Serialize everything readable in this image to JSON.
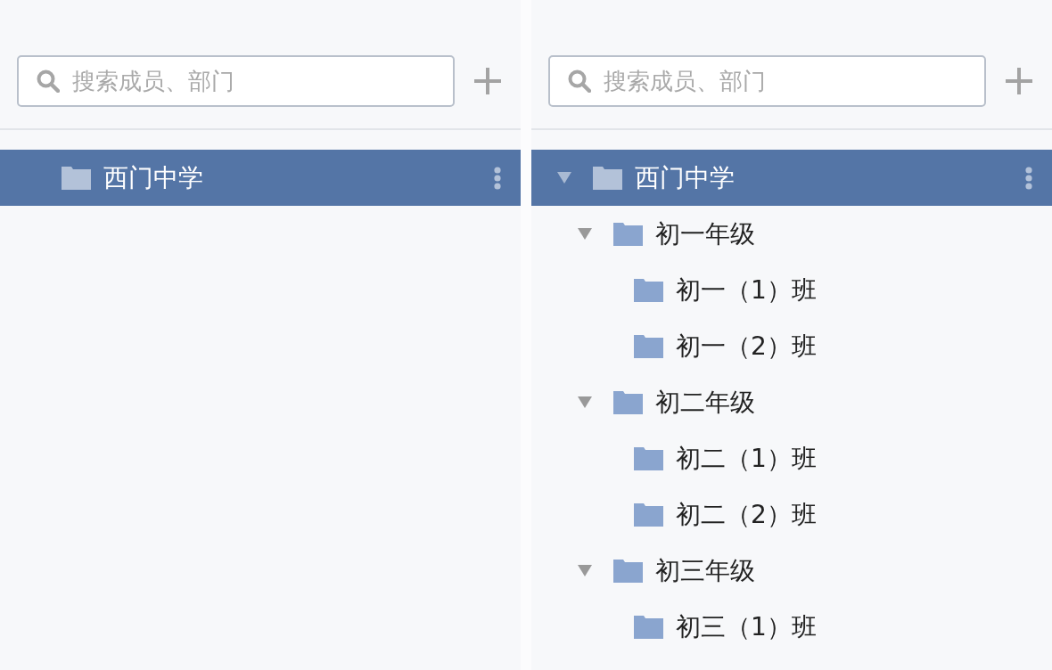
{
  "panels": [
    {
      "search": {
        "placeholder": "搜索成员、部门"
      },
      "tree": [
        {
          "label": "西门中学",
          "selected": true
        }
      ]
    },
    {
      "search": {
        "placeholder": "搜索成员、部门"
      },
      "tree": [
        {
          "label": "西门中学",
          "selected": true,
          "expanded": true,
          "children": [
            {
              "label": "初一年级",
              "selected": false,
              "expanded": true,
              "children": [
                {
                  "label": "初一（1）班",
                  "selected": false
                },
                {
                  "label": "初一（2）班",
                  "selected": false
                }
              ]
            },
            {
              "label": "初二年级",
              "selected": false,
              "expanded": true,
              "children": [
                {
                  "label": "初二（1）班",
                  "selected": false
                },
                {
                  "label": "初二（2）班",
                  "selected": false
                }
              ]
            },
            {
              "label": "初三年级",
              "selected": false,
              "expanded": true,
              "children": [
                {
                  "label": "初三（1）班",
                  "selected": false
                }
              ]
            }
          ]
        }
      ]
    }
  ]
}
